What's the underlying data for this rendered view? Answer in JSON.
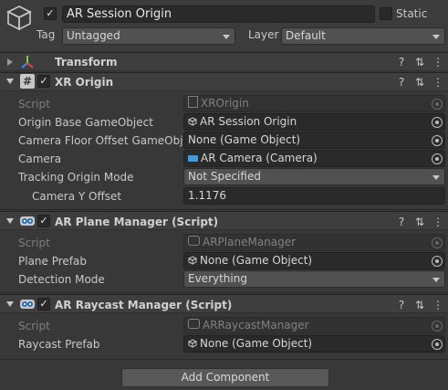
{
  "header": {
    "object_name": "AR Session Origin",
    "active": true,
    "static_label": "Static",
    "static_checked": false,
    "tag_label": "Tag",
    "tag_value": "Untagged",
    "layer_label": "Layer",
    "layer_value": "Default"
  },
  "components": {
    "transform": {
      "title": "Transform"
    },
    "xr_origin": {
      "title": "XR Origin",
      "enabled": true,
      "fields": {
        "script_label": "Script",
        "script_value": "XROrigin",
        "origin_base_label": "Origin Base GameObject",
        "origin_base_value": "AR Session Origin",
        "camera_floor_label": "Camera Floor Offset GameObjec",
        "camera_floor_value": "None (Game Object)",
        "camera_label": "Camera",
        "camera_value": "AR Camera (Camera)",
        "tracking_label": "Tracking Origin Mode",
        "tracking_value": "Not Specified",
        "camera_y_label": "Camera Y Offset",
        "camera_y_value": "1.1176"
      }
    },
    "plane_manager": {
      "title": "AR Plane Manager (Script)",
      "enabled": true,
      "fields": {
        "script_label": "Script",
        "script_value": "ARPlaneManager",
        "plane_prefab_label": "Plane Prefab",
        "plane_prefab_value": "None (Game Object)",
        "detection_label": "Detection Mode",
        "detection_value": "Everything"
      }
    },
    "raycast_manager": {
      "title": "AR Raycast Manager (Script)",
      "enabled": true,
      "fields": {
        "script_label": "Script",
        "script_value": "ARRaycastManager",
        "raycast_prefab_label": "Raycast Prefab",
        "raycast_prefab_value": "None (Game Object)"
      }
    }
  },
  "footer": {
    "add_component_label": "Add Component"
  },
  "icons": {
    "gameobject": "cube-icon",
    "transform": "transform-axes-icon",
    "xr_origin": "script-hash-icon",
    "plane_manager": "ar-component-icon",
    "help": "help-icon",
    "presets": "presets-icon",
    "menu": "kebab-menu-icon"
  },
  "colors": {
    "background": "#383838",
    "header_bg": "#3c3c3c",
    "field_bg": "#2a2a2a",
    "dropdown_bg": "#515151",
    "transform_red": "#e3463c",
    "transform_green": "#7fcc4b",
    "transform_blue": "#3f8fe0"
  }
}
